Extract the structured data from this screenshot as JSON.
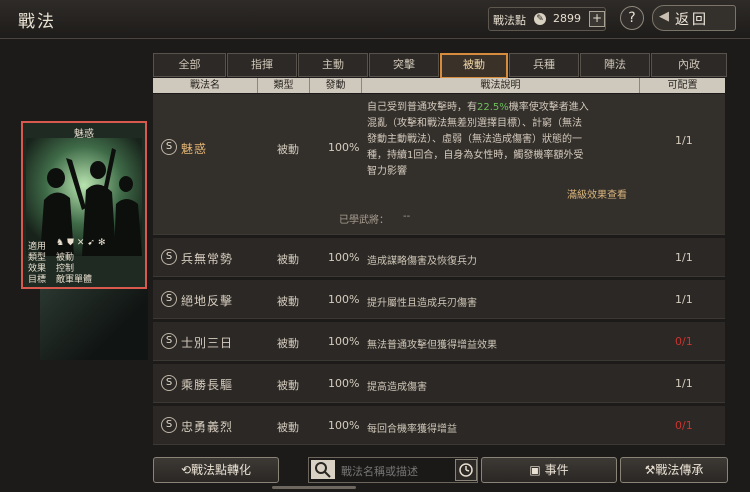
{
  "header": {
    "title": "戰法",
    "points_label": "戰法點",
    "points_value": "2899",
    "plus": "+",
    "help": "?",
    "back_label": "返回"
  },
  "tabs": [
    "全部",
    "指揮",
    "主動",
    "突擊",
    "被動",
    "兵種",
    "陣法",
    "內政"
  ],
  "active_tab": "被動",
  "columns": [
    "戰法名",
    "類型",
    "發動",
    "戰法說明",
    "可配置"
  ],
  "selected_row": {
    "badge": "S",
    "name": "魅惑",
    "type": "被動",
    "rate": "100%",
    "desc_line1_pre": "自己受到普通攻擊時，有",
    "desc_highlight": "22.5%",
    "desc_line1_post": "機率使攻擊者進入",
    "desc_line2": "混亂（攻擊和戰法無差別選擇目標）、計窮（無法",
    "desc_line3": "發動主動戰法）、虛弱（無法造成傷害）狀態的一",
    "desc_line4": "種，持續1回合，自身為女性時，觸發機率額外受",
    "desc_line5": "智力影響",
    "limit": "1/1",
    "full_effect": "滿級效果查看",
    "learned_label": "已學武將：",
    "learned_value": "--"
  },
  "rows": [
    {
      "badge": "S",
      "name": "兵無常勢",
      "type": "被動",
      "rate": "100%",
      "desc": "造成謀略傷害及恢復兵力",
      "limit": "1/1"
    },
    {
      "badge": "S",
      "name": "絕地反擊",
      "type": "被動",
      "rate": "100%",
      "desc": "提升屬性且造成兵刃傷害",
      "limit": "1/1"
    },
    {
      "badge": "S",
      "name": "士別三日",
      "type": "被動",
      "rate": "100%",
      "desc": "無法普通攻擊但獲得增益效果",
      "limit": "0/1"
    },
    {
      "badge": "S",
      "name": "乘勝長驅",
      "type": "被動",
      "rate": "100%",
      "desc": "提高造成傷害",
      "limit": "1/1"
    },
    {
      "badge": "S",
      "name": "忠勇義烈",
      "type": "被動",
      "rate": "100%",
      "desc": "每回合機率獲得增益",
      "limit": "0/1"
    }
  ],
  "card": {
    "title": "魅惑",
    "use_label": "適用",
    "type_label": "類型",
    "type_value": "被動",
    "effect_label": "效果",
    "effect_value": "控制",
    "target_label": "目標",
    "target_value": "敵軍單體"
  },
  "bottom": {
    "convert_label": "戰法點轉化",
    "search_placeholder": "戰法名稱或描述",
    "events_label": "事件",
    "inherit_label": "戰法傳承"
  },
  "colors": {
    "accent": "#d78b3c",
    "highlight_green": "#6cbf5c",
    "unavailable_red": "#c8342f",
    "card_border": "#d85a4f"
  }
}
